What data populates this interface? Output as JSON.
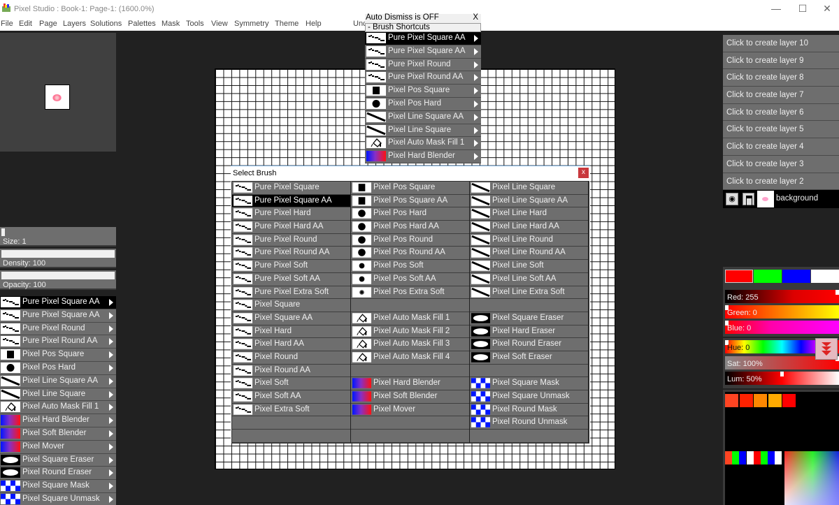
{
  "window": {
    "title": "Pixel Studio : Book-1: Page-1:  (1600.0%)",
    "controls": [
      "minimize",
      "maximize",
      "close"
    ]
  },
  "menu": [
    "File",
    "Edit",
    "Page",
    "Layers",
    "Solutions",
    "Palettes",
    "Mask",
    "Tools",
    "View",
    "Symmetry",
    "Theme",
    "Help",
    "Unc"
  ],
  "left_panel": {
    "size_label": "Size: 1",
    "size_value": 1,
    "density_label": "Density: 100",
    "density_value": 100,
    "opacity_label": "Opacity: 100",
    "opacity_value": 100,
    "brush_list": [
      {
        "label": "Pure Pixel Square AA",
        "icon": "pure-pixel-icon",
        "selected": true
      },
      {
        "label": "Pure Pixel Square AA",
        "icon": "pure-pixel-icon"
      },
      {
        "label": "Pure Pixel Round",
        "icon": "pure-pixel-icon"
      },
      {
        "label": "Pure Pixel Round AA",
        "icon": "pure-pixel-icon"
      },
      {
        "label": "Pixel Pos Square",
        "icon": "square-icon"
      },
      {
        "label": "Pixel Pos Hard",
        "icon": "circle-icon"
      },
      {
        "label": "Pixel Line Square AA",
        "icon": "line-icon"
      },
      {
        "label": "Pixel Line Square",
        "icon": "line-icon"
      },
      {
        "label": "Pixel Auto Mask Fill 1",
        "icon": "bucket-icon"
      },
      {
        "label": "Pixel Hard Blender",
        "icon": "blender-icon"
      },
      {
        "label": "Pixel Soft Blender",
        "icon": "blender-icon"
      },
      {
        "label": "Pixel Mover",
        "icon": "blender-icon"
      },
      {
        "label": "Pixel Square Eraser",
        "icon": "eraser-icon"
      },
      {
        "label": "Pixel Round Eraser",
        "icon": "eraser-icon"
      },
      {
        "label": "Pixel Square Mask",
        "icon": "mask-icon"
      },
      {
        "label": "Pixel Square Unmask",
        "icon": "mask-icon"
      }
    ]
  },
  "shortcut_popup": {
    "header": "Auto Dismiss is OFF",
    "close": "X",
    "subheader": "-  Brush Shortcuts",
    "items": [
      {
        "label": "Pure Pixel Square AA",
        "icon": "pure-pixel-icon",
        "selected": true
      },
      {
        "label": "Pure Pixel Square AA",
        "icon": "pure-pixel-icon"
      },
      {
        "label": "Pure Pixel Round",
        "icon": "pure-pixel-icon"
      },
      {
        "label": "Pure Pixel Round AA",
        "icon": "pure-pixel-icon"
      },
      {
        "label": "Pixel Pos Square",
        "icon": "square-icon"
      },
      {
        "label": "Pixel Pos Hard",
        "icon": "circle-icon"
      },
      {
        "label": "Pixel Line Square AA",
        "icon": "line-icon"
      },
      {
        "label": "Pixel Line Square",
        "icon": "line-icon"
      },
      {
        "label": "Pixel Auto Mask Fill 1",
        "icon": "bucket-icon"
      },
      {
        "label": "Pixel Hard Blender",
        "icon": "blender-icon"
      }
    ]
  },
  "select_brush_dialog": {
    "title": "Select Brush",
    "close": "x",
    "columns": [
      [
        {
          "label": "Pure Pixel Square",
          "icon": "pure-pixel-icon"
        },
        {
          "label": "Pure Pixel Square AA",
          "icon": "pure-pixel-icon",
          "selected": true
        },
        {
          "label": "Pure Pixel Hard",
          "icon": "pure-pixel-icon"
        },
        {
          "label": "Pure Pixel Hard AA",
          "icon": "pure-pixel-icon"
        },
        {
          "label": "Pure Pixel Round",
          "icon": "pure-pixel-icon"
        },
        {
          "label": "Pure Pixel Round AA",
          "icon": "pure-pixel-icon"
        },
        {
          "label": "Pure Pixel Soft",
          "icon": "pure-pixel-icon"
        },
        {
          "label": "Pure Pixel Soft AA",
          "icon": "pure-pixel-icon"
        },
        {
          "label": "Pure Pixel Extra Soft",
          "icon": "pure-pixel-icon"
        },
        {
          "label": "Pixel Square",
          "icon": "pure-pixel-icon"
        },
        {
          "label": "Pixel Square AA",
          "icon": "pure-pixel-icon"
        },
        {
          "label": "Pixel Hard",
          "icon": "pure-pixel-icon"
        },
        {
          "label": "Pixel Hard AA",
          "icon": "pure-pixel-icon"
        },
        {
          "label": "Pixel Round",
          "icon": "pure-pixel-icon"
        },
        {
          "label": "Pixel Round AA",
          "icon": "pure-pixel-icon"
        },
        {
          "label": "Pixel Soft",
          "icon": "pure-pixel-icon"
        },
        {
          "label": "Pixel Soft AA",
          "icon": "pure-pixel-icon"
        },
        {
          "label": "Pixel Extra Soft",
          "icon": "pure-pixel-icon"
        },
        {
          "label": "",
          "icon": ""
        },
        {
          "label": "",
          "icon": ""
        }
      ],
      [
        {
          "label": "Pixel Pos Square",
          "icon": "square-icon"
        },
        {
          "label": "Pixel Pos Square AA",
          "icon": "square-icon"
        },
        {
          "label": "Pixel Pos Hard",
          "icon": "circle-icon"
        },
        {
          "label": "Pixel Pos Hard AA",
          "icon": "circle-icon"
        },
        {
          "label": "Pixel Pos Round",
          "icon": "circle-icon"
        },
        {
          "label": "Pixel Pos Round AA",
          "icon": "circle-icon"
        },
        {
          "label": "Pixel Pos Soft",
          "icon": "small-circle-icon"
        },
        {
          "label": "Pixel Pos Soft AA",
          "icon": "small-circle-icon"
        },
        {
          "label": "Pixel Pos Extra Soft",
          "icon": "soft-dot-icon"
        },
        {
          "label": "",
          "icon": ""
        },
        {
          "label": "Pixel Auto Mask Fill 1",
          "icon": "bucket-icon"
        },
        {
          "label": "Pixel Auto Mask Fill 2",
          "icon": "bucket-icon"
        },
        {
          "label": "Pixel Auto Mask Fill 3",
          "icon": "bucket-icon"
        },
        {
          "label": "Pixel Auto Mask Fill 4",
          "icon": "bucket-icon"
        },
        {
          "label": "",
          "icon": ""
        },
        {
          "label": "Pixel Hard Blender",
          "icon": "blender-icon"
        },
        {
          "label": "Pixel Soft Blender",
          "icon": "blender-icon"
        },
        {
          "label": "Pixel Mover",
          "icon": "blender-icon"
        },
        {
          "label": "",
          "icon": ""
        },
        {
          "label": "",
          "icon": ""
        }
      ],
      [
        {
          "label": "Pixel Line Square",
          "icon": "line-icon"
        },
        {
          "label": "Pixel Line Square AA",
          "icon": "line-icon"
        },
        {
          "label": "Pixel Line Hard",
          "icon": "line-icon"
        },
        {
          "label": "Pixel Line Hard AA",
          "icon": "line-icon"
        },
        {
          "label": "Pixel Line Round",
          "icon": "line-icon"
        },
        {
          "label": "Pixel Line Round AA",
          "icon": "line-icon"
        },
        {
          "label": "Pixel Line Soft",
          "icon": "line-icon"
        },
        {
          "label": "Pixel Line Soft AA",
          "icon": "line-icon"
        },
        {
          "label": "Pixel Line Extra Soft",
          "icon": "line-icon"
        },
        {
          "label": "",
          "icon": ""
        },
        {
          "label": "Pixel Square Eraser",
          "icon": "eraser-icon"
        },
        {
          "label": "Pixel Hard Eraser",
          "icon": "eraser-icon"
        },
        {
          "label": "Pixel Round Eraser",
          "icon": "eraser-icon"
        },
        {
          "label": "Pixel Soft Eraser",
          "icon": "eraser-icon"
        },
        {
          "label": "",
          "icon": ""
        },
        {
          "label": "Pixel Square Mask",
          "icon": "mask-icon"
        },
        {
          "label": "Pixel Square Unmask",
          "icon": "mask-icon"
        },
        {
          "label": "Pixel Round Mask",
          "icon": "mask-icon"
        },
        {
          "label": "Pixel Round Unmask",
          "icon": "mask-icon"
        },
        {
          "label": "",
          "icon": ""
        }
      ]
    ]
  },
  "layers": {
    "create_items": [
      "Click to create layer 10",
      "Click to create layer 9",
      "Click to create layer 8",
      "Click to create layer 7",
      "Click to create layer 6",
      "Click to create layer 5",
      "Click to create layer 4",
      "Click to create layer 3",
      "Click to create layer 2"
    ],
    "background_name": "background"
  },
  "colors": {
    "swatches": [
      "#ff0000",
      "#00ff00",
      "#0000ff",
      "#ffffff"
    ],
    "red_label": "Red: 255",
    "red": 255,
    "green_label": "Green: 0",
    "green": 0,
    "blue_label": "Blue: 0",
    "blue": 0,
    "hue_label": "Hue: 0",
    "hue": 0,
    "sat_label": "Sat: 100%",
    "sat": 100,
    "lum_label": "Lum: 50%",
    "lum": 50,
    "palette_row": [
      "#ff4422",
      "#ff2200",
      "#ff8800",
      "#ffaa00",
      "#ff0000"
    ],
    "mini_row": [
      "#ff4422",
      "#00ff00",
      "#0000ff",
      "#ffffff",
      "#ff0000",
      "#00ff00",
      "#0000ff",
      "#ffffff"
    ]
  }
}
